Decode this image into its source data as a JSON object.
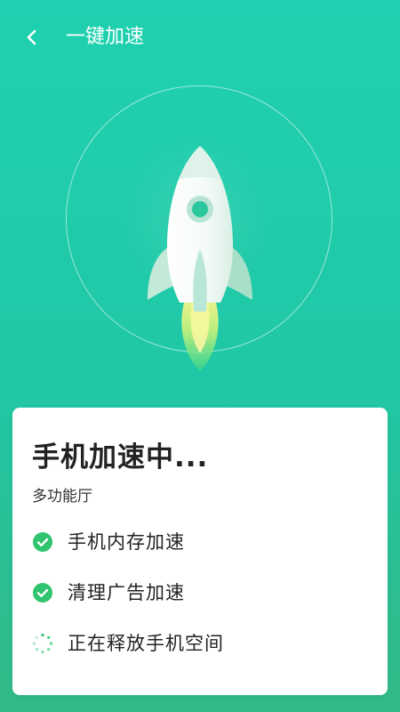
{
  "header": {
    "title": "一键加速"
  },
  "card": {
    "title": "手机加速中...",
    "subtitle": "多功能厅",
    "tasks": [
      {
        "label": "手机内存加速",
        "status": "done"
      },
      {
        "label": "清理广告加速",
        "status": "done"
      },
      {
        "label": "正在释放手机空间",
        "status": "in-progress"
      }
    ]
  },
  "colors": {
    "background_top": "#1fd1b0",
    "background_bottom": "#33b986",
    "check_green": "#2fc46d",
    "rocket_body": "#eef7f2",
    "rocket_fin": "#bfe8d8",
    "flame": "#f2f37a"
  },
  "icons": {
    "back": "back-arrow-icon",
    "done": "check-circle-icon",
    "progress": "spinner-icon"
  }
}
